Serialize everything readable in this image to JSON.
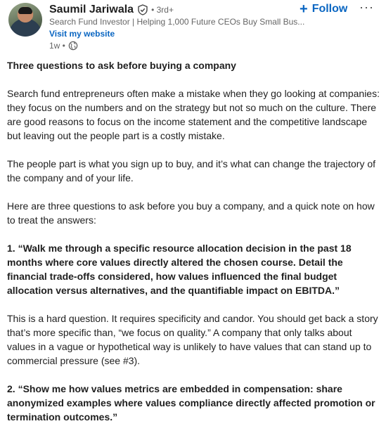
{
  "author": {
    "name": "Saumil Jariwala",
    "degree": "• 3rd+",
    "headline": "Search Fund Investor | Helping 1,000 Future CEOs Buy Small Bus...",
    "website_label": "Visit my website",
    "time": "1w •",
    "verified_icon": "verified-shield-icon",
    "visibility_icon": "globe-icon"
  },
  "actions": {
    "follow_label": "Follow",
    "follow_plus": "+",
    "more_label": "···"
  },
  "post": {
    "title": "Three questions to ask before buying a company",
    "p1": "Search fund entrepreneurs often make a mistake when they go looking at companies: they focus on the numbers and on the strategy but not so much on the culture. There are good reasons to focus on the income statement and the competitive landscape but leaving out the people part is a costly mistake.",
    "p2": "The people part is what you sign up to buy, and it’s what can change the trajectory of the company and of your life.",
    "p3": "Here are three questions to ask before you buy a company, and a quick note on how to treat the answers:",
    "q1": "1. “Walk me through a specific resource allocation decision in the past 18 months where core values directly altered the chosen course. Detail the financial trade-offs considered, how values influenced the final budget allocation versus alternatives, and the quantifiable impact on EBITDA.”",
    "p4": "This is a hard question. It requires specificity and candor. You should get back a story that’s more specific than, “we focus on quality.” A company that only talks about values in a vague or hypothetical way is unlikely to have values that can stand up to commercial pressure (see #3).",
    "q2": "2. “Show me how values metrics are embedded in compensation: share anonymized examples where values compliance directly affected promotion or termination outcomes.”"
  },
  "colors": {
    "accent": "#0a66c2",
    "text": "#1f1f1f",
    "muted": "#666666"
  }
}
